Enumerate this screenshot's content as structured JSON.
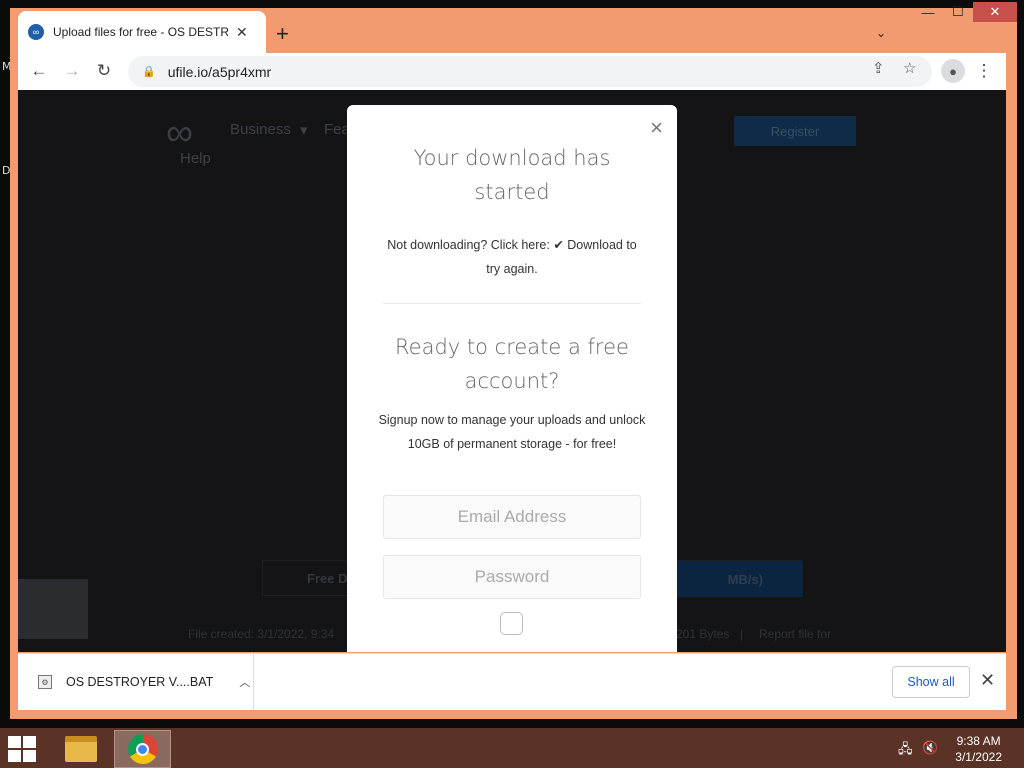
{
  "desktop": {
    "side_letters": [
      "M",
      "D"
    ]
  },
  "browser": {
    "tab": {
      "title": "Upload files for free - OS DESTROYER",
      "favicon": "ufile-logo-icon"
    },
    "new_tab_symbol": "+",
    "address": {
      "url": "ufile.io/a5pr4xmr"
    }
  },
  "background_page": {
    "nav_business": "Business",
    "nav_features": "Fea",
    "nav_help": "Help",
    "register_button": "Register",
    "free_download_label": "Free D",
    "speed_label": "MB/s)",
    "footer_created": "File created: 3/1/2022, 9:34",
    "footer_size": "201 Bytes",
    "footer_separator": "|",
    "footer_report": "Report file for"
  },
  "modal": {
    "close_symbol": "×",
    "download_heading": "Your download has started",
    "not_downloading_prefix": "Not downloading? Click here: ",
    "download_link": "✔ Download",
    "not_downloading_suffix": " to try again.",
    "account_heading": "Ready to create a free account?",
    "signup_text": "Signup now to manage your uploads and unlock 10GB of permanent storage - for free!",
    "email_placeholder": "Email Address",
    "password_placeholder": "Password"
  },
  "download_bar": {
    "file_name": "OS DESTROYER V....BAT",
    "show_all": "Show all",
    "close_symbol": "✕"
  },
  "taskbar": {
    "time": "9:38 AM",
    "date": "3/1/2022"
  },
  "colors": {
    "window_frame": "#f29b70",
    "taskbar": "#5b3226",
    "link_blue": "#1a5bbd"
  }
}
